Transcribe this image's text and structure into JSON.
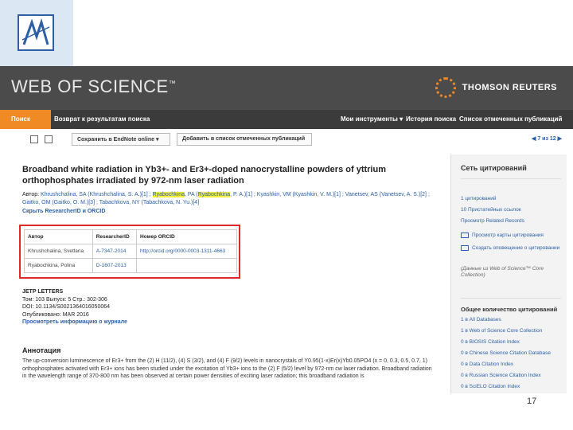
{
  "brand": {
    "wos": "WEB OF SCIENCE",
    "tm": "™",
    "tr": "THOMSON REUTERS"
  },
  "colors": {
    "accent": "#f08a24",
    "link": "#2b5fa7",
    "highlight": "#f6ef3b",
    "box": "#e02a2a"
  },
  "nav": {
    "search": "Поиск",
    "back": "Возврат к результатам поиска",
    "tools": "Мои инструменты ▾",
    "history": "История поиска",
    "marked": "Список отмеченных публикаций"
  },
  "toolbar": {
    "save": "Сохранить в EndNote online",
    "add": "Добавить в список отмеченных публикаций",
    "pager": "◀ 7 из 12 ▶"
  },
  "article": {
    "title": "Broadband white radiation in Yb3+- and Er3+-doped nanocrystalline powders of yttrium orthophosphates irradiated by 972-nm laser radiation",
    "author_label": "Автор:",
    "authors_1": "Khrushchalina, SA (Khrushchalina, S. A.)[1] ;",
    "authors_hl_1": "Ryabochkina",
    "authors_2": ", PA (",
    "authors_hl_2": "Ryabochkina",
    "authors_3": ", P. A.)[1] ; Kyashkin, VM (Kyashkin, V. M.)[1] ; Vanetsev, AS (Vanetsev, A. S.)[2] ; Gaitko, OM (Gaitko, O. M.)[3] ; Tabachkova, NY (Tabachkova, N. Yu.)[4]",
    "collapse": "Скрыть ResearcherID и ORCID"
  },
  "rid_table": {
    "headers": [
      "Автор",
      "ResearcherID",
      "Номер ORCID"
    ],
    "rows": [
      [
        "Khrushchalina, Svetlana",
        "A-7347-2014",
        "http://orcid.org/0000-0003-1311-4663"
      ],
      [
        "Ryabochkina, Polina",
        "D-1607-2013",
        ""
      ]
    ]
  },
  "journal": {
    "name": "JETP LETTERS",
    "vol": "Том: 103   Выпуск: 5   Стр.: 302-306",
    "doi": "DOI: 10.1134/S0021364016050064",
    "pub": "Опубликовано: MAR 2016",
    "link": "Просмотреть информацию о журнале"
  },
  "abstract": {
    "head": "Аннотация",
    "body": "The up-conversion luminescence of Er3+ from the (2) H (11/2), (4) S (3/2), and (4) F (9/2) levels in nanocrystals of Y0.95(1-x)Er(x)Yb0.05PO4 (x = 0, 0.3, 0.5, 0.7, 1) orthophosphates activated with Er3+ ions has been studied under the excitation of Yb3+ ions to the (2) F (5/2) level by 972-nm cw laser radiation. Broadband radiation in the wavelength range of 370-800 nm has been observed at certain power densities of exciting laser radiation; this broadband radiation is"
  },
  "sidebar": {
    "head": "Сеть цитирований",
    "l1": "1 цитирований",
    "l2": "10 Пристатейных ссылок",
    "l3": "Просмотр Related Records",
    "l4": "Просмотр карты цитирования",
    "l5": "Создать оповещение о цитировании",
    "note": "(Данные из Web of Science™ Core Collection)",
    "head2": "Общее количество цитирований",
    "c1": "1 в All Databases",
    "c2": "1 в Web of Science Core Collection",
    "c3": "0 в BIOSIS Citation Index",
    "c4": "0 в Chinese Science Citation Database",
    "c5": "0 в Data Citation Index",
    "c6": "0 в Russian Science Citation Index",
    "c7": "0 в SciELO Citation Index"
  },
  "page_number": "17"
}
